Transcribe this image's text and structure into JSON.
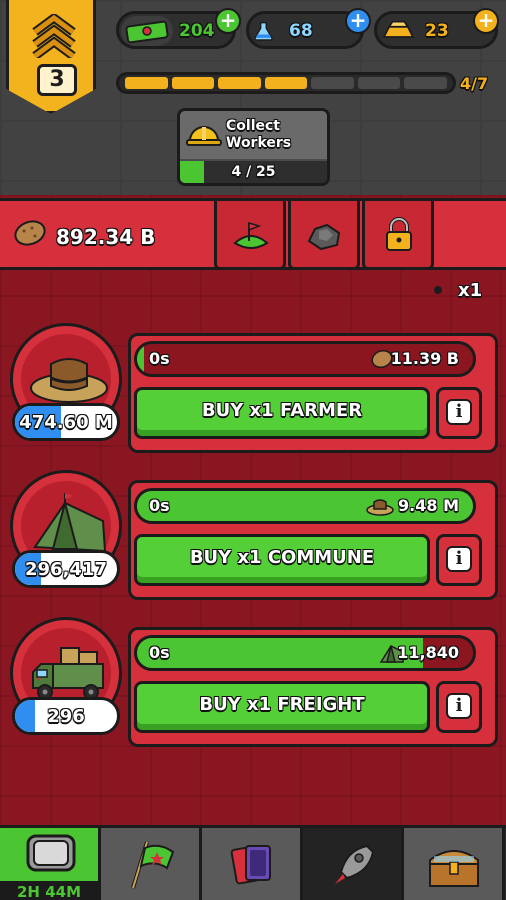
{
  "header": {
    "rank": "3",
    "resources": [
      {
        "name": "cash",
        "value": "204",
        "icon": "green-banknote-icon",
        "accent": "#4cc532"
      },
      {
        "name": "science",
        "value": "68",
        "icon": "flask-icon",
        "accent": "#2f8ef0"
      },
      {
        "name": "gold",
        "value": "23",
        "icon": "gold-bar-icon",
        "accent": "#f3b21d"
      }
    ],
    "progress": {
      "label": "4/7",
      "filled": 4,
      "total": 7
    }
  },
  "collect": {
    "label_line1": "Collect",
    "label_line2": "Workers",
    "count": "4 / 25",
    "progress": 0.16
  },
  "resource_bar": {
    "total": "892.34 B",
    "tabs": [
      "farm-land-icon",
      "ore-icon",
      "lock-icon"
    ]
  },
  "multiplier": "x1",
  "producers": [
    {
      "name": "farmer",
      "owned": "474.60 M",
      "owned_fill": 0.45,
      "time": "0s",
      "yield": "11.39 B",
      "yield_icon": "potato-icon",
      "timer_fill": 0.02,
      "buy_label": "BUY x1 FARMER"
    },
    {
      "name": "commune",
      "owned": "296,417",
      "owned_fill": 0.25,
      "time": "0s",
      "yield": "9.48 M",
      "yield_icon": "straw-hat-icon",
      "timer_fill": 1.0,
      "buy_label": "BUY x1 COMMUNE"
    },
    {
      "name": "freight",
      "owned": "296",
      "owned_fill": 0.2,
      "time": "0s",
      "yield": "11,840",
      "yield_icon": "tent-icon",
      "timer_fill": 0.85,
      "buy_label": "BUY x1 FREIGHT"
    }
  ],
  "nav": {
    "tabs": [
      "tv-icon",
      "flag-icon",
      "cards-icon",
      "rocket-icon",
      "treasure-chest-icon"
    ],
    "timer": "2H 44M"
  },
  "colors": {
    "panel_red": "#d5303c",
    "panel_dark": "#8a1622",
    "green": "#4cc532",
    "blue": "#2f8ef0",
    "gold": "#f3b21d"
  }
}
